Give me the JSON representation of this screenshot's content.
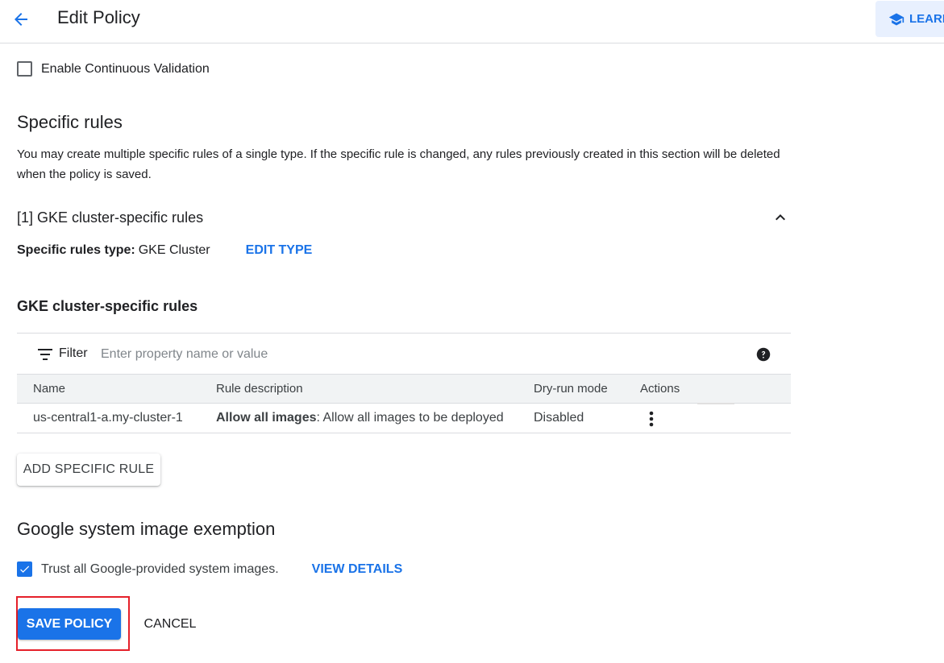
{
  "header": {
    "title": "Edit Policy",
    "learn_label": "LEARN"
  },
  "continuous_validation": {
    "label": "Enable Continuous Validation",
    "checked": false
  },
  "specific_rules": {
    "heading": "Specific rules",
    "description": "You may create multiple specific rules of a single type. If the specific rule is changed, any rules previously created in this section will be deleted when the policy is saved.",
    "group_title": "[1] GKE cluster-specific rules",
    "type_key": "Specific rules type:",
    "type_value": "GKE Cluster",
    "edit_type_label": "EDIT TYPE"
  },
  "gke_rules": {
    "heading": "GKE cluster-specific rules",
    "filter_label": "Filter",
    "filter_placeholder": "Enter property name or value",
    "columns": [
      "Name",
      "Rule description",
      "Dry-run mode",
      "Actions"
    ],
    "rows": [
      {
        "name": "us-central1-a.my-cluster-1",
        "rule_bold": "Allow all images",
        "rule_rest": ": Allow all images to be deployed",
        "dry_run": "Disabled"
      }
    ],
    "add_rule_label": "ADD SPECIFIC RULE"
  },
  "exemption": {
    "heading": "Google system image exemption",
    "trust_label": "Trust all Google-provided system images.",
    "trust_checked": true,
    "view_details_label": "VIEW DETAILS"
  },
  "footer": {
    "save_label": "SAVE POLICY",
    "cancel_label": "CANCEL"
  },
  "colors": {
    "primary": "#1a73e8",
    "highlight": "#e5202a",
    "text": "#202124",
    "table_header_bg": "#f1f3f4"
  }
}
